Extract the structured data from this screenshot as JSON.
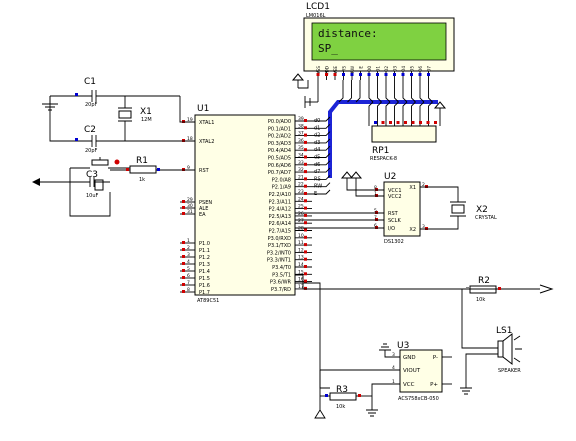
{
  "lcd": {
    "ref": "LCD1",
    "part": "LM016L",
    "line1": "distance:",
    "line2": "SP_",
    "pin_labels": [
      "VSS",
      "VDD",
      "VEE",
      "RS",
      "RW",
      "E",
      "D0",
      "D1",
      "D2",
      "D3",
      "D4",
      "D5",
      "D6",
      "D7"
    ]
  },
  "u1": {
    "ref": "U1",
    "part": "AT89C51",
    "left_pins": [
      {
        "num": "19",
        "name": "XTAL1"
      },
      {
        "num": "18",
        "name": "XTAL2"
      },
      {
        "num": "9",
        "name": "RST"
      },
      {
        "num": "29",
        "name": "PSEN"
      },
      {
        "num": "30",
        "name": "ALE"
      },
      {
        "num": "31",
        "name": "EA"
      },
      {
        "num": "1",
        "name": "P1.0"
      },
      {
        "num": "2",
        "name": "P1.1"
      },
      {
        "num": "3",
        "name": "P1.2"
      },
      {
        "num": "4",
        "name": "P1.3"
      },
      {
        "num": "5",
        "name": "P1.4"
      },
      {
        "num": "6",
        "name": "P1.5"
      },
      {
        "num": "7",
        "name": "P1.6"
      },
      {
        "num": "8",
        "name": "P1.7"
      }
    ],
    "right_pins": [
      {
        "num": "39",
        "name": "P0.0/AD0",
        "net": "d0"
      },
      {
        "num": "38",
        "name": "P0.1/AD1",
        "net": "d1"
      },
      {
        "num": "37",
        "name": "P0.2/AD2",
        "net": "d2"
      },
      {
        "num": "36",
        "name": "P0.3/AD3",
        "net": "d3"
      },
      {
        "num": "35",
        "name": "P0.4/AD4",
        "net": "d4"
      },
      {
        "num": "34",
        "name": "P0.5/AD5",
        "net": "d5"
      },
      {
        "num": "33",
        "name": "P0.6/AD6",
        "net": "d6"
      },
      {
        "num": "32",
        "name": "P0.7/AD7",
        "net": "d7"
      },
      {
        "num": "21",
        "name": "P2.0/A8",
        "net": "RS"
      },
      {
        "num": "22",
        "name": "P2.1/A9",
        "net": "RW"
      },
      {
        "num": "23",
        "name": "P2.2/A10",
        "net": "E"
      },
      {
        "num": "24",
        "name": "P2.3/A11",
        "net": ""
      },
      {
        "num": "25",
        "name": "P2.4/A12",
        "net": ""
      },
      {
        "num": "26",
        "name": "P2.5/A13",
        "net": ""
      },
      {
        "num": "27",
        "name": "P2.6/A14",
        "net": ""
      },
      {
        "num": "28",
        "name": "P2.7/A15",
        "net": ""
      },
      {
        "num": "10",
        "name": "P3.0/RXD",
        "net": ""
      },
      {
        "num": "11",
        "name": "P3.1/TXD",
        "net": ""
      },
      {
        "num": "12",
        "name": "P3.2/INT0",
        "net": ""
      },
      {
        "num": "13",
        "name": "P3.3/INT1",
        "net": ""
      },
      {
        "num": "14",
        "name": "P3.4/T0",
        "net": ""
      },
      {
        "num": "15",
        "name": "P3.5/T1",
        "net": ""
      },
      {
        "num": "16",
        "name": "P3.6/WR",
        "net": ""
      },
      {
        "num": "17",
        "name": "P3.7/RD",
        "net": ""
      }
    ]
  },
  "c1": {
    "ref": "C1",
    "value": "20pF"
  },
  "c2": {
    "ref": "C2",
    "value": "20pF"
  },
  "c3": {
    "ref": "C3",
    "value": "10uF"
  },
  "x1": {
    "ref": "X1",
    "value": "12M"
  },
  "r1": {
    "ref": "R1",
    "value": "1k"
  },
  "u2": {
    "ref": "U2",
    "part": "DS1302",
    "pins": [
      {
        "num": "8",
        "name": "VCC1"
      },
      {
        "num": "1",
        "name": "VCC2"
      },
      {
        "num": "2",
        "name": "X1"
      },
      {
        "num": "5",
        "name": "RST"
      },
      {
        "num": "7",
        "name": "SCLK"
      },
      {
        "num": "6",
        "name": "I/O"
      },
      {
        "num": "3",
        "name": "X2"
      }
    ]
  },
  "x2": {
    "ref": "X2",
    "value": "CRYSTAL"
  },
  "rp1": {
    "ref": "RP1",
    "value": "RESPACK-8"
  },
  "r2": {
    "ref": "R2",
    "value": "10k"
  },
  "r3": {
    "ref": "R3",
    "value": "10k"
  },
  "ls1": {
    "ref": "LS1",
    "value": "SPEAKER"
  },
  "u3": {
    "ref": "U3",
    "part": "ACS758xCB-050",
    "pins": [
      {
        "num": "3",
        "name": "GND"
      },
      {
        "num": "4",
        "name": "VIOUT"
      },
      {
        "num": "1",
        "name": "VCC"
      },
      {
        "num": "P-",
        "name": "P-"
      },
      {
        "num": "P+",
        "name": "P+"
      }
    ]
  }
}
